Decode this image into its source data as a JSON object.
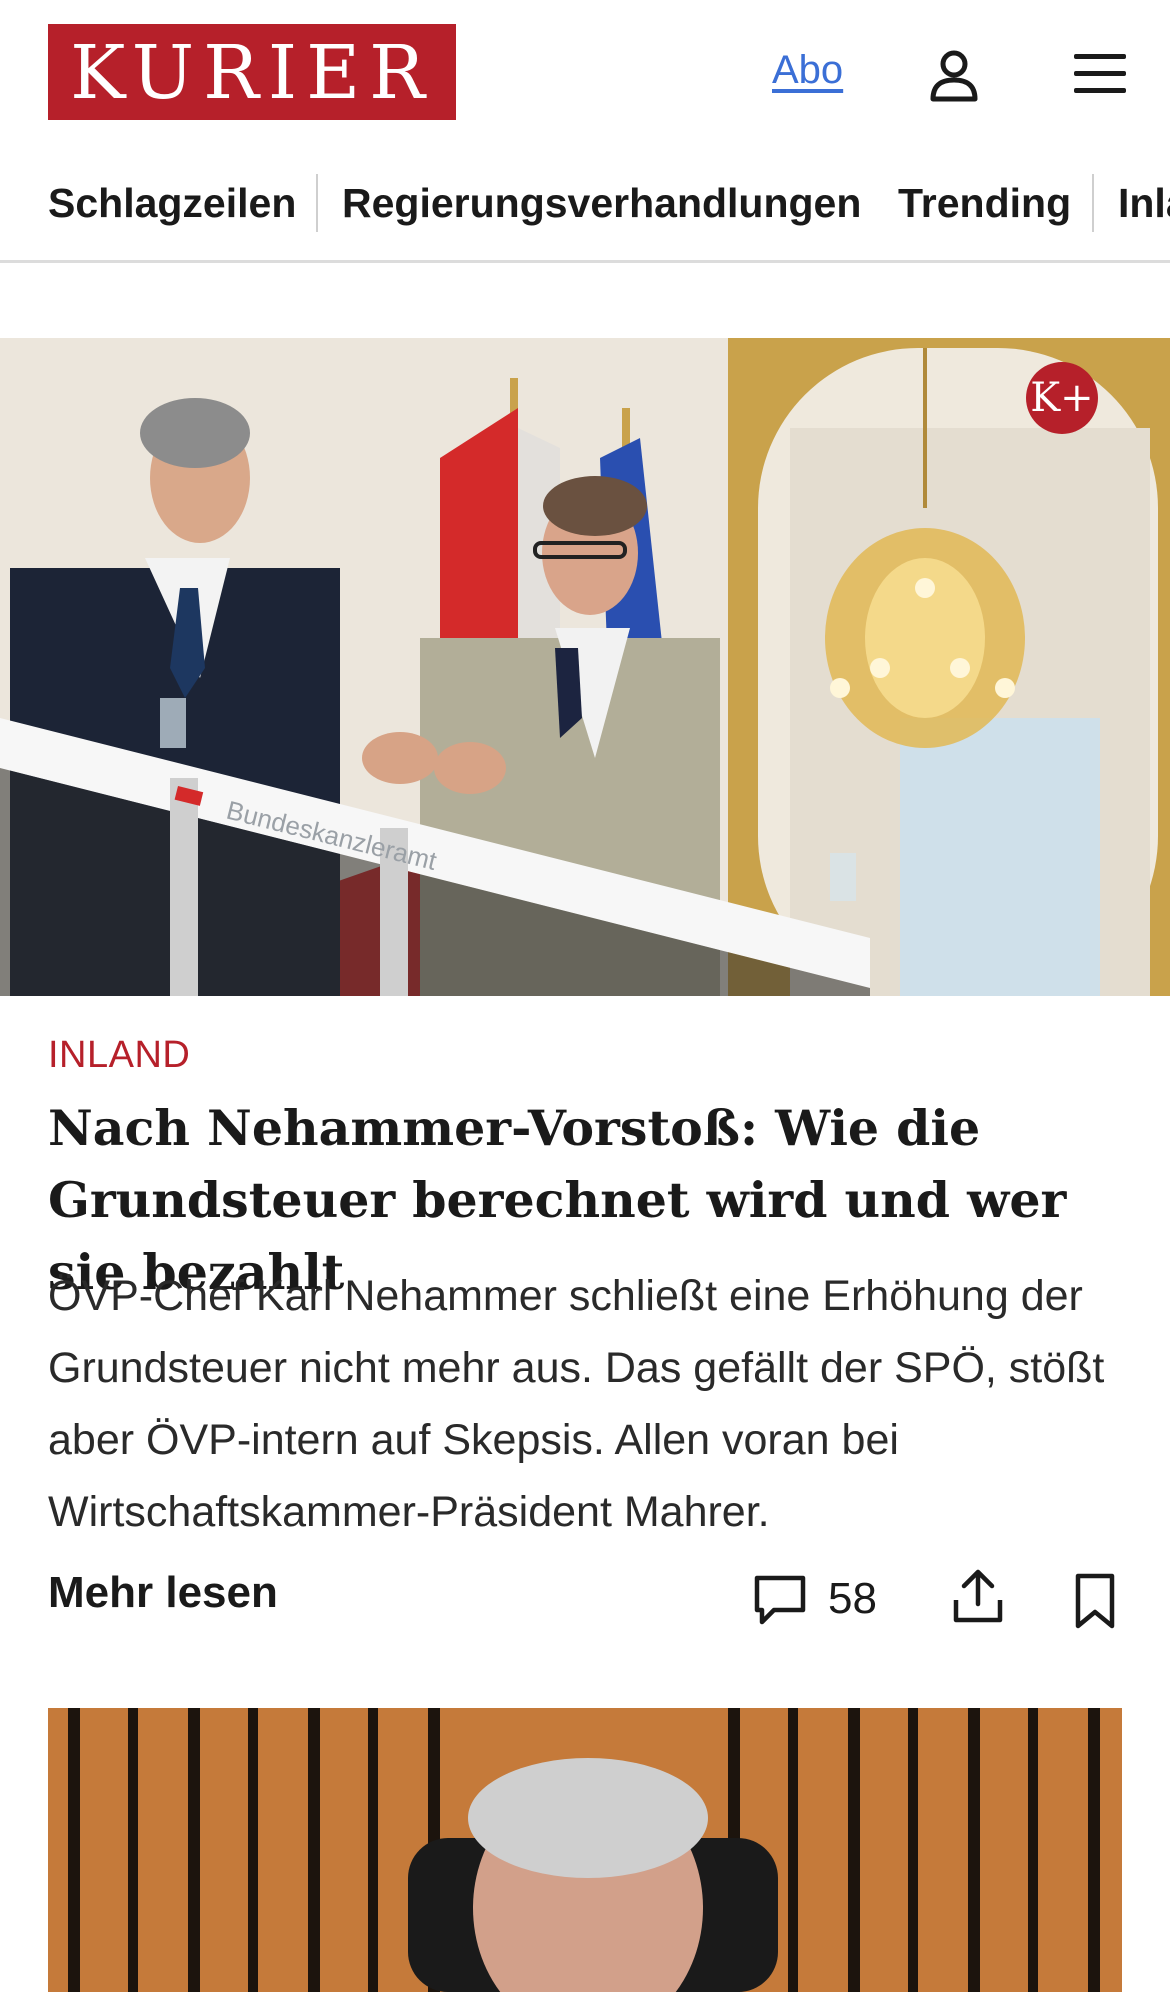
{
  "header": {
    "logo_text": "KURIER",
    "abo_label": "Abo",
    "user_icon": "user-icon",
    "menu_icon": "menu-icon"
  },
  "nav": {
    "items": [
      {
        "label": "Schlagzeilen"
      },
      {
        "label": "Regierungsverhandlungen"
      },
      {
        "label": "Trending"
      },
      {
        "label": "Inland"
      }
    ]
  },
  "article": {
    "badge_text": "K+",
    "kicker": "INLAND",
    "headline": "Nach Nehammer-Vorstoß: Wie die Grund­steuer berechnet wird und wer sie bezahlt",
    "teaser": "ÖVP-Chef Karl Nehammer schließt eine Erhöhung der Grundsteuer nicht mehr aus. Das gefällt der SPÖ, stößt aber ÖVP-intern auf Skepsis. Allen voran bei Wirtschaftskammer-Präsident Mahrer.",
    "more_label": "Mehr lesen",
    "comment_count": "58",
    "image_label": "Bundeskanzleramt"
  },
  "colors": {
    "brand_red": "#b6202a",
    "link_blue": "#3b6fd6"
  }
}
